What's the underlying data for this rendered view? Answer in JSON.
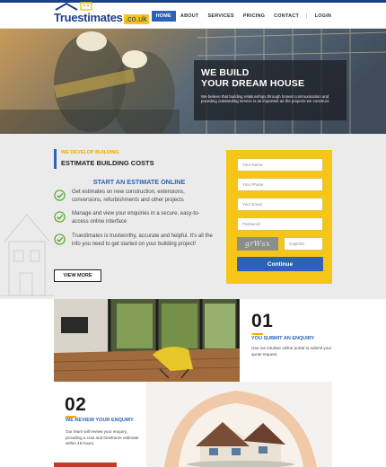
{
  "header": {
    "logo_text": "Truestimates",
    "logo_tld": ".co.uk",
    "nav": [
      {
        "label": "HOME",
        "active": true
      },
      {
        "label": "ABOUT",
        "active": false
      },
      {
        "label": "SERVICES",
        "active": false
      },
      {
        "label": "PRICING",
        "active": false
      },
      {
        "label": "CONTACT",
        "active": false
      }
    ],
    "separator": "|",
    "login": "LOGIN"
  },
  "hero": {
    "title_line1": "WE BUILD",
    "title_line2": "YOUR DREAM HOUSE",
    "subtitle": "We believe that building relationships through honest communication and providing outstanding service is as important as the projects we construct."
  },
  "estimate": {
    "tag_small": "WE DEVELOP BUILDING",
    "tag_big": "ESTIMATE BUILDING COSTS",
    "start_title": "START AN ESTIMATE ONLINE",
    "features": [
      "Get estimates on new construction, extensions, conversions, refurbishments and other projects",
      "Manage and view your enquiries in a secure, easy-to-access online interface",
      "Truestimates is trustworthy, accurate and helpful. It's all the info you need to get started on your building project!"
    ],
    "view_more": "VIEW MORE"
  },
  "form": {
    "name_placeholder": "Your Name",
    "phone_placeholder": "Your Phone",
    "email_placeholder": "Your Email",
    "password_placeholder": "Password",
    "captcha_image_text": "grWsx",
    "captcha_placeholder": "Captcha",
    "continue_label": "Continue"
  },
  "steps": [
    {
      "number": "01",
      "title": "YOU SUBMIT AN ENQUIRY",
      "text": "Use our intuitive online portal to submit your quote request."
    },
    {
      "number": "02",
      "title": "WE REVIEW YOUR ENQUIRY",
      "text": "Our team will review your enquiry, providing a cost and timeframe estimate within 48 hours."
    }
  ],
  "colors": {
    "brand_blue": "#2d62b8",
    "accent_yellow": "#f5c518",
    "accent_orange": "#f5a800",
    "check_green": "#5aaa2e"
  }
}
